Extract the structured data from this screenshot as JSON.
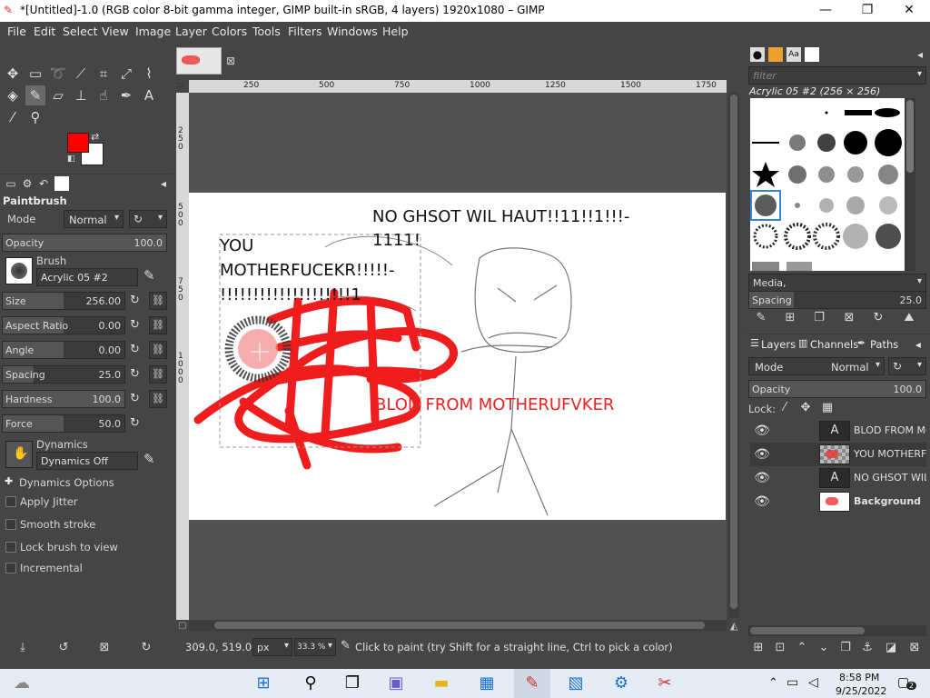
{
  "window": {
    "title": "*[Untitled]-1.0 (RGB color 8-bit gamma integer, GIMP built-in sRGB, 4 layers) 1920x1080 – GIMP",
    "minimize": "—",
    "maximize": "❐",
    "close": "✕"
  },
  "menu": [
    "File",
    "Edit",
    "Select",
    "View",
    "Image",
    "Layer",
    "Colors",
    "Tools",
    "Filters",
    "Windows",
    "Help"
  ],
  "tool_options": {
    "title": "Paintbrush",
    "mode_label": "Mode",
    "mode_value": "Normal",
    "opacity_label": "Opacity",
    "opacity_value": "100.0",
    "brush_label": "Brush",
    "brush_value": "Acrylic 05 #2",
    "sliders": [
      {
        "label": "Size",
        "value": "256.00",
        "fill": 0.5
      },
      {
        "label": "Aspect Ratio",
        "value": "0.00",
        "fill": 0.5
      },
      {
        "label": "Angle",
        "value": "0.00",
        "fill": 0.5
      },
      {
        "label": "Spacing",
        "value": "25.0",
        "fill": 0.25
      },
      {
        "label": "Hardness",
        "value": "100.0",
        "fill": 1.0
      },
      {
        "label": "Force",
        "value": "50.0",
        "fill": 0.5
      }
    ],
    "dynamics_label": "Dynamics",
    "dynamics_value": "Dynamics Off",
    "dynamics_options": "Dynamics Options",
    "checks": [
      "Apply Jitter",
      "Smooth stroke",
      "Lock brush to view",
      "Incremental"
    ]
  },
  "colors": {
    "foreground": "#ff0000",
    "background": "#ffffff"
  },
  "ruler": {
    "h_labels": [
      "250",
      "500",
      "750",
      "1000",
      "1250",
      "1500",
      "1750"
    ],
    "v_labels": [
      "250",
      "500",
      "750",
      "1000"
    ]
  },
  "image_text": {
    "t1": "NO GHSOT WIL HAUT!!11!!1!!!-",
    "t1b": "1111!",
    "t2": "YOU",
    "t2b": "MOTHERFUCEKR!!!!!-",
    "t2c": "!!!!!!!!!!!!!!!!!!!!1",
    "t3": "BLOD FROM MOTHERUFVKER"
  },
  "status": {
    "coords": "309.0, 519.0",
    "unit": "px",
    "zoom": "33.3 %",
    "message": "Click to paint (try Shift for a straight line, Ctrl to pick a color)"
  },
  "brushes": {
    "filter_placeholder": "filter",
    "current": "Acrylic 05 #2 (256 × 256)",
    "tag": "Media,",
    "spacing_label": "Spacing",
    "spacing_value": "25.0"
  },
  "layers": {
    "tabs": [
      "Layers",
      "Channels",
      "Paths"
    ],
    "mode_label": "Mode",
    "mode_value": "Normal",
    "opacity_label": "Opacity",
    "opacity_value": "100.0",
    "lock_label": "Lock:",
    "items": [
      {
        "name": "BLOD FROM MC",
        "type": "text"
      },
      {
        "name": "YOU MOTHERFU",
        "type": "checker"
      },
      {
        "name": "NO GHSOT WIL I",
        "type": "text"
      },
      {
        "name": "Background",
        "type": "bg"
      }
    ]
  },
  "taskbar": {
    "time": "8:58 PM",
    "date": "9/25/2022",
    "notif": "2"
  }
}
